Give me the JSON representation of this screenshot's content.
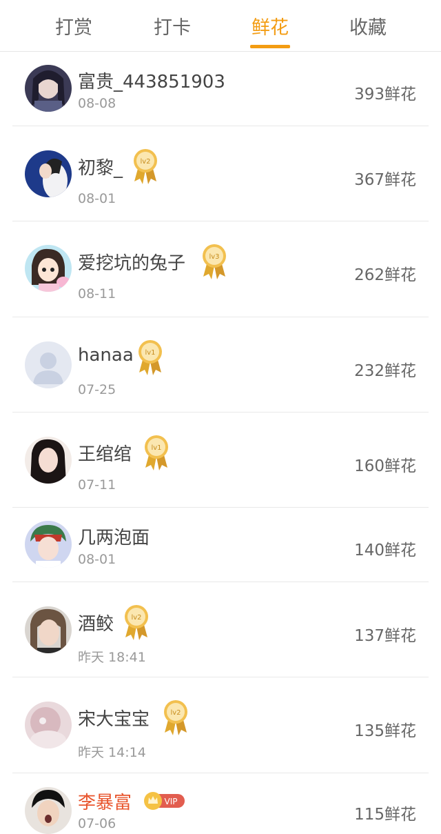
{
  "tabs": [
    "打赏",
    "打卡",
    "鲜花",
    "收藏"
  ],
  "active_tab": "鲜花",
  "colors": {
    "accent": "#f39c12",
    "vip_name": "#e8542c",
    "medal_gold": "#e0a82e"
  },
  "rows": [
    {
      "name": "富贵_443851903",
      "date": "08-08",
      "count": "393鲜花",
      "badge": ""
    },
    {
      "name": "初黎_",
      "date": "08-01",
      "count": "367鲜花",
      "badge": "lv2"
    },
    {
      "name": "爱挖坑的兔子",
      "date": "08-11",
      "count": "262鲜花",
      "badge": "lv3"
    },
    {
      "name": "hanaa",
      "date": "07-25",
      "count": "232鲜花",
      "badge": "lv1"
    },
    {
      "name": "王绾绾",
      "date": "07-11",
      "count": "160鲜花",
      "badge": "lv1"
    },
    {
      "name": "几两泡面",
      "date": "08-01",
      "count": "140鲜花",
      "badge": ""
    },
    {
      "name": "酒鲛",
      "date": "昨天 18:41",
      "count": "137鲜花",
      "badge": "lv2"
    },
    {
      "name": "宋大宝宝",
      "date": "昨天 14:14",
      "count": "135鲜花",
      "badge": "lv2"
    },
    {
      "name": "李暴富",
      "date": "07-06",
      "count": "115鲜花",
      "badge": "VIP"
    }
  ]
}
